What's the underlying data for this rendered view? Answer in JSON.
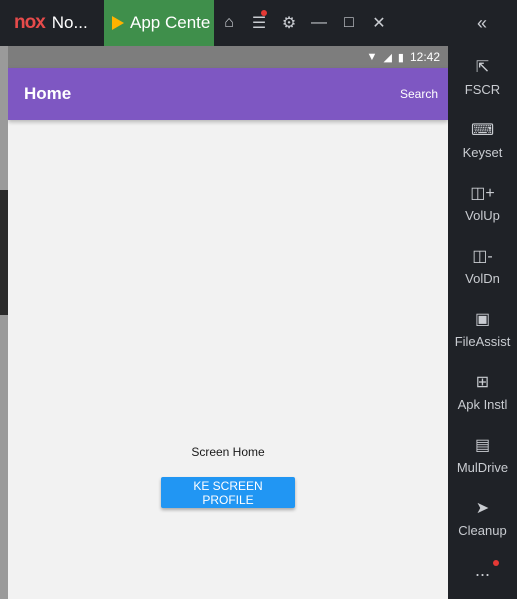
{
  "emulator": {
    "brand_logo": "nox",
    "window_title": "No...",
    "app_center_tab": "App Cente",
    "titlebar_icons": [
      "shirt-icon",
      "menu-icon",
      "gear-icon",
      "minimize-icon",
      "maximize-icon",
      "close-icon"
    ],
    "collapse_icon": "double-chevron-left-icon",
    "sidebar": [
      {
        "label": "FSCR",
        "icon": "fullscreen-icon"
      },
      {
        "label": "Keyset",
        "icon": "keyboard-icon"
      },
      {
        "label": "VolUp",
        "icon": "volume-up-icon"
      },
      {
        "label": "VolDn",
        "icon": "volume-down-icon"
      },
      {
        "label": "FileAssist",
        "icon": "monitor-icon"
      },
      {
        "label": "Apk Instl",
        "icon": "apk-icon"
      },
      {
        "label": "MulDrive",
        "icon": "multi-drive-icon"
      },
      {
        "label": "Cleanup",
        "icon": "rocket-icon"
      }
    ],
    "more_label": "..."
  },
  "phone": {
    "status": {
      "time": "12:42"
    },
    "appbar": {
      "title": "Home",
      "action": "Search"
    },
    "screen_label": "Screen Home",
    "profile_button": "KE SCREEN PROFILE"
  },
  "colors": {
    "appbar": "#7e57c2",
    "button": "#2196f3",
    "app_center": "#3f8f4b",
    "emulator_chrome": "#1f2227"
  }
}
